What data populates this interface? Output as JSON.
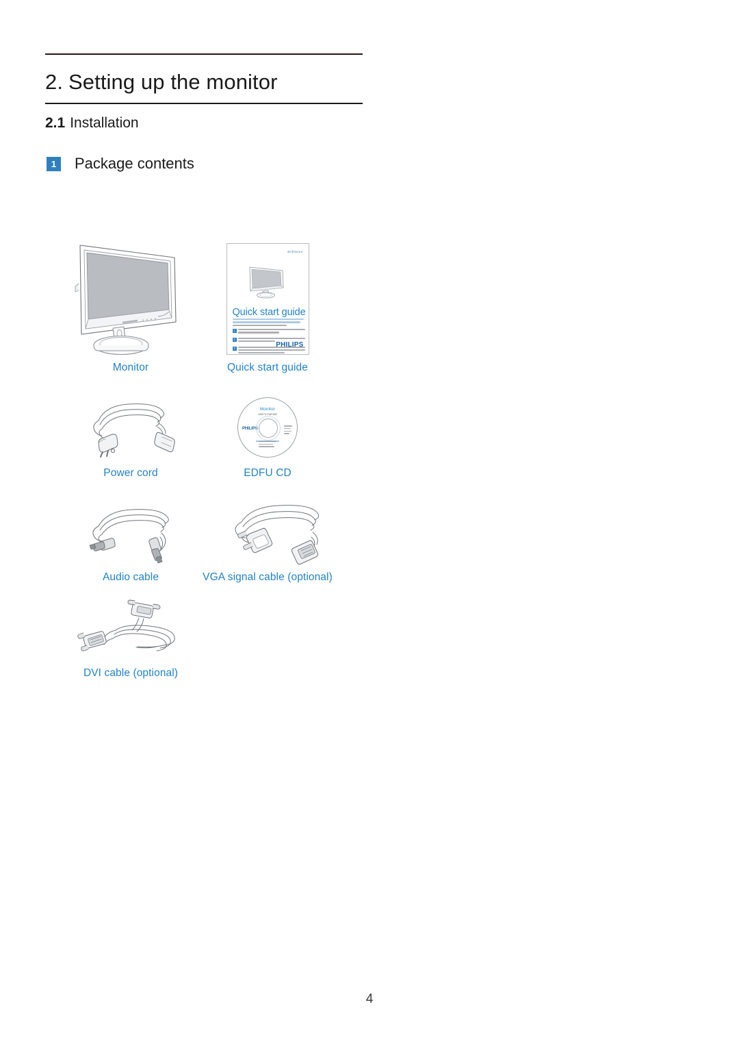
{
  "document": {
    "page_number": "4"
  },
  "header": {
    "chapter_number": "2.",
    "chapter_title": "Setting up the monitor",
    "section_number": "2.1",
    "section_title": "Installation"
  },
  "subsection": {
    "badge": "1",
    "label": "Package contents"
  },
  "package_items": [
    {
      "id": "monitor",
      "label": "Monitor",
      "art": "monitor-illustration"
    },
    {
      "id": "quick-start",
      "label": "Quick start guide",
      "art": "quick-start-guide-illustration"
    },
    {
      "id": "power-cord",
      "label": "Power cord",
      "art": "power-cord-illustration"
    },
    {
      "id": "edfu-cd",
      "label": "EDFU CD",
      "art": "cd-disc-illustration"
    },
    {
      "id": "audio-cable",
      "label": "Audio cable",
      "art": "audio-cable-illustration"
    },
    {
      "id": "vga-cable",
      "label": "VGA signal cable (optional)",
      "art": "vga-cable-illustration"
    },
    {
      "id": "dvi-cable",
      "label": "DVI cable (optional)",
      "art": "dvi-cable-illustration"
    }
  ],
  "quick_start_guide_cover": {
    "brand_mark": "Brilliance",
    "title": "Quick start guide",
    "philips_logo": "PHILIPS",
    "steps": [
      "1",
      "2",
      "3"
    ]
  },
  "cd_label": {
    "title": "Monitor",
    "subtitle": "user's manual",
    "philips_logo": "PHILIPS"
  },
  "colors": {
    "caption_blue": "#2183c8",
    "badge_blue": "#2f7fbf",
    "rule_dark": "#1a1a1a",
    "text_dark": "#1a1a1a"
  }
}
